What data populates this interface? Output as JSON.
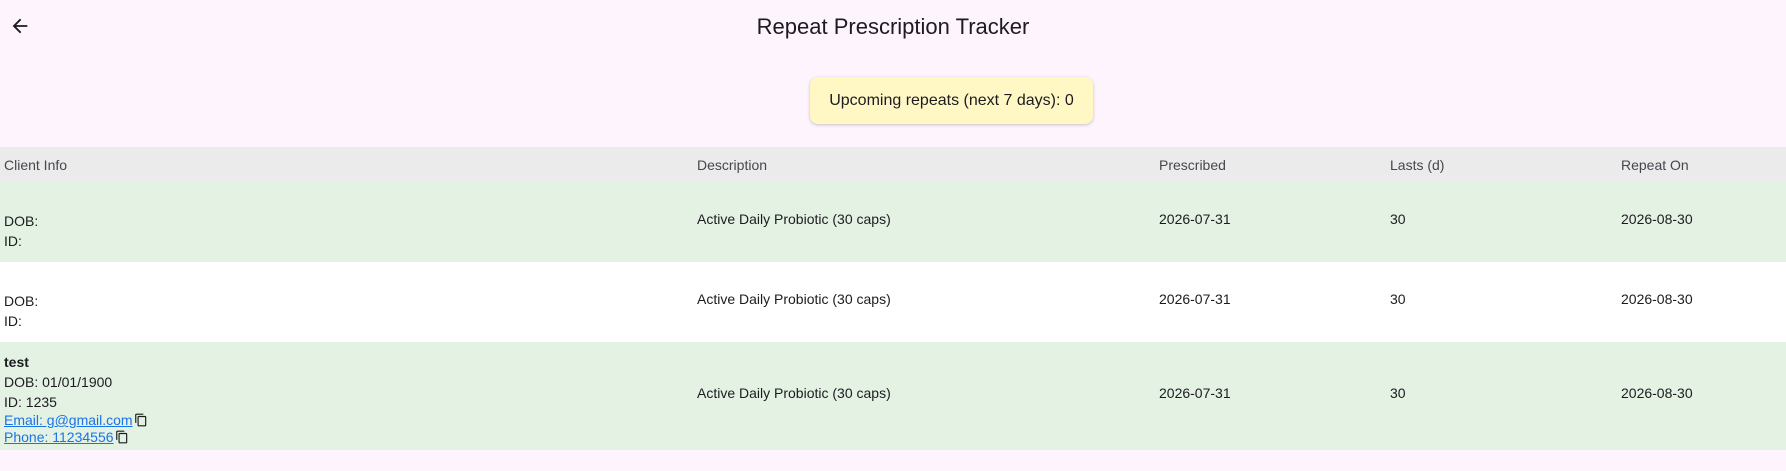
{
  "header": {
    "title": "Repeat Prescription Tracker",
    "back_icon": "arrow-left-icon"
  },
  "summary": {
    "text": "Upcoming repeats (next 7 days): 0"
  },
  "table": {
    "columns": [
      "Client Info",
      "Description",
      "Prescribed",
      "Lasts (d)",
      "Repeat On"
    ],
    "rows": [
      {
        "name": "",
        "dob": "DOB:",
        "id": "ID:",
        "email": "",
        "phone": "",
        "description": "Active Daily Probiotic (30 caps)",
        "prescribed": "2026-07-31",
        "lasts": "30",
        "repeat_on": "2026-08-30"
      },
      {
        "name": "",
        "dob": "DOB:",
        "id": "ID:",
        "email": "",
        "phone": "",
        "description": "Active Daily Probiotic (30 caps)",
        "prescribed": "2026-07-31",
        "lasts": "30",
        "repeat_on": "2026-08-30"
      },
      {
        "name": "test",
        "dob": "DOB: 01/01/1900",
        "id": "ID: 1235",
        "email": "Email: g@gmail.com",
        "phone": "Phone: 11234556",
        "description": "Active Daily Probiotic (30 caps)",
        "prescribed": "2026-07-31",
        "lasts": "30",
        "repeat_on": "2026-08-30"
      }
    ]
  },
  "colors": {
    "page_bg": "#fef4fd",
    "summary_bg": "#fff8c5",
    "header_bg": "#ebebeb",
    "row_green": "#e3f2e3",
    "row_white": "#ffffff",
    "link": "#1a73e8"
  }
}
